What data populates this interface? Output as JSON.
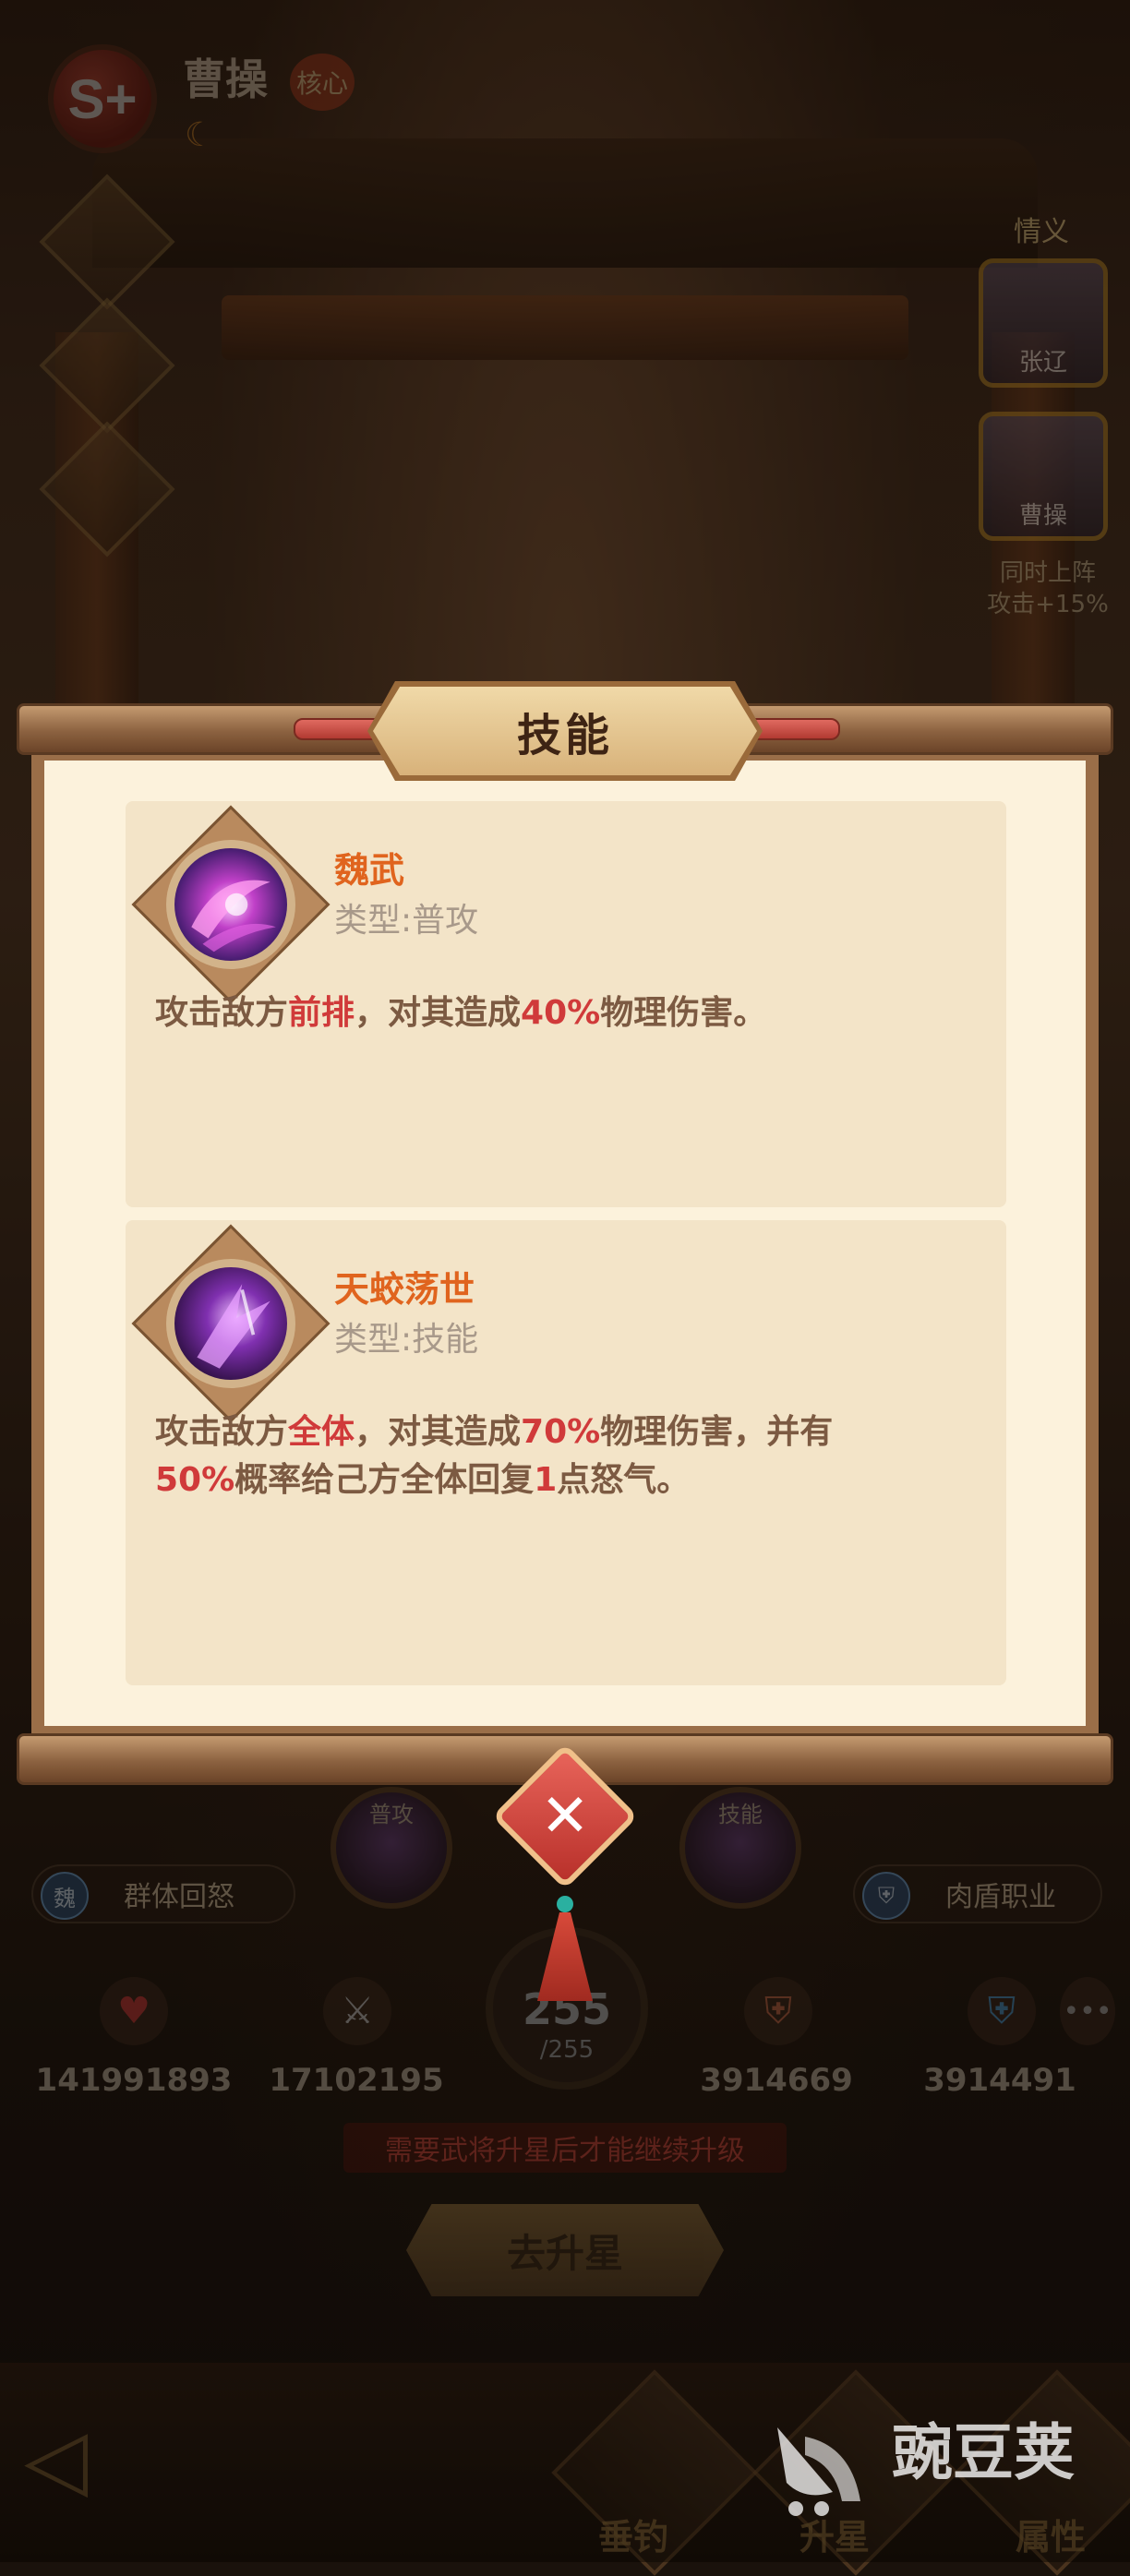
{
  "hero": {
    "rank": "S+",
    "name": "曹操",
    "core_tag": "核心"
  },
  "bond": {
    "label": "情义",
    "partners": [
      "张辽",
      "曹操"
    ],
    "bonus_line1": "同时上阵",
    "bonus_line2": "攻击+15%"
  },
  "dialog": {
    "title": "技能",
    "skills": [
      {
        "name": "魏武",
        "type": "类型:普攻",
        "desc_parts": [
          "攻击敌方",
          "前排",
          "，对其造成",
          "40%",
          "物理伤害。"
        ]
      },
      {
        "name": "天蛟荡世",
        "type": "类型:技能",
        "desc_parts": [
          "攻击敌方",
          "全体",
          "，对其造成",
          "70%",
          "物理伤害，并有",
          "50%",
          "概率给己方全体回复",
          "1",
          "点怒气。"
        ]
      }
    ]
  },
  "background": {
    "orb_labels": [
      "普攻",
      "技能"
    ],
    "faction_pill": {
      "icon": "魏",
      "label": "群体回怒"
    },
    "class_pill": {
      "label": "肉盾职业"
    },
    "stats": [
      "141991893",
      "17102195",
      "3914669",
      "3914491"
    ],
    "level": "255",
    "level_max": "/255",
    "upgrade_notice": "需要武将升星后才能继续升级",
    "go_star_button": "去升星",
    "nav_tabs": [
      "垂钓",
      "升星",
      "属性"
    ],
    "watermark": "豌豆荚"
  },
  "colors": {
    "accent_orange": "#e0641e",
    "highlight_red": "#d03a3a",
    "paper": "#fcf2dc",
    "card": "#f3e4c8"
  }
}
